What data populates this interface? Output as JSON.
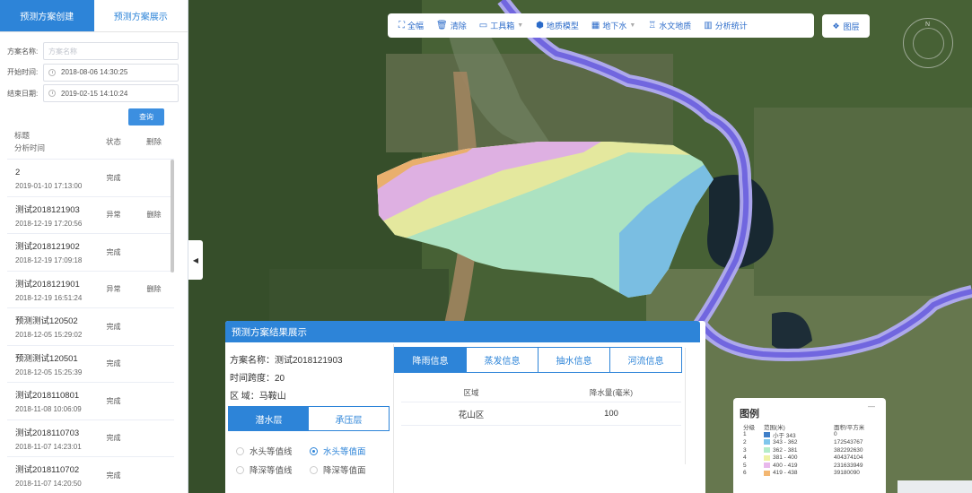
{
  "tabs": [
    {
      "label": "预测方案创建",
      "active": true
    },
    {
      "label": "预测方案展示",
      "active": false
    }
  ],
  "form": {
    "name_label": "方案名称:",
    "name_placeholder": "方案名称",
    "start_label": "开始时间:",
    "start_value": "2018-08-06 14:30:25",
    "end_label": "结束日期:",
    "end_value": "2019-02-15 14:10:24",
    "query_label": "查询"
  },
  "table": {
    "header": {
      "title": "标题",
      "time": "分析时间",
      "status": "状态",
      "delete": "删除"
    },
    "rows": [
      {
        "name": "2",
        "time": "2019-01-10 17:13:00",
        "status": "完成",
        "action": ""
      },
      {
        "name": "测试2018121903",
        "time": "2018-12-19 17:20:56",
        "status": "异常",
        "action": "删除"
      },
      {
        "name": "测试2018121902",
        "time": "2018-12-19 17:09:18",
        "status": "完成",
        "action": ""
      },
      {
        "name": "测试2018121901",
        "time": "2018-12-19 16:51:24",
        "status": "异常",
        "action": "删除"
      },
      {
        "name": "预测测试120502",
        "time": "2018-12-05 15:29:02",
        "status": "完成",
        "action": ""
      },
      {
        "name": "预测测试120501",
        "time": "2018-12-05 15:25:39",
        "status": "完成",
        "action": ""
      },
      {
        "name": "测试2018110801",
        "time": "2018-11-08 10:06:09",
        "status": "完成",
        "action": ""
      },
      {
        "name": "测试2018110703",
        "time": "2018-11-07 14:23:01",
        "status": "完成",
        "action": ""
      },
      {
        "name": "测试2018110702",
        "time": "2018-11-07 14:20:50",
        "status": "完成",
        "action": ""
      }
    ]
  },
  "toolbar": {
    "full_extent": "全幅",
    "clear": "清除",
    "toolbox": "工具箱",
    "geo_model": "地质模型",
    "groundwater": "地下水",
    "hydro_geo": "水文地质",
    "analysis": "分析统计",
    "layers": "图层"
  },
  "compass_label": "N",
  "result": {
    "title": "预测方案结果展示",
    "scheme_name": "方案名称：测试2018121903",
    "time_span": "时间跨度：20",
    "region": "区 域：马鞍山",
    "layer_tabs": [
      {
        "label": "潜水层",
        "active": true
      },
      {
        "label": "承压层",
        "active": false
      }
    ],
    "radios": [
      {
        "label": "水头等值线",
        "checked": false
      },
      {
        "label": "水头等值面",
        "checked": true
      },
      {
        "label": "降深等值线",
        "checked": false
      },
      {
        "label": "降深等值面",
        "checked": false
      }
    ],
    "info_tabs": [
      {
        "label": "降雨信息",
        "active": true
      },
      {
        "label": "蒸发信息",
        "active": false
      },
      {
        "label": "抽水信息",
        "active": false
      },
      {
        "label": "河流信息",
        "active": false
      }
    ],
    "rain_table": {
      "headers": [
        "区域",
        "降水量(毫米)"
      ],
      "rows": [
        [
          "花山区",
          "100"
        ]
      ]
    }
  },
  "legend": {
    "title": "图例",
    "close": "—",
    "headers": [
      "分级",
      "范围(米)",
      "面积/平方米"
    ],
    "rows": [
      {
        "level": "1",
        "range": "小于 343",
        "area": "0",
        "color": "#3f7fc8"
      },
      {
        "level": "2",
        "range": "343 - 362",
        "area": "172543767",
        "color": "#7fc6ec"
      },
      {
        "level": "3",
        "range": "362 - 381",
        "area": "382292630",
        "color": "#b4ecc9"
      },
      {
        "level": "4",
        "range": "381 - 400",
        "area": "404374104",
        "color": "#eef2a5"
      },
      {
        "level": "5",
        "range": "400 - 419",
        "area": "231633949",
        "color": "#e8b8ec"
      },
      {
        "level": "6",
        "range": "419 - 438",
        "area": "39180090",
        "color": "#f3b772"
      }
    ]
  }
}
